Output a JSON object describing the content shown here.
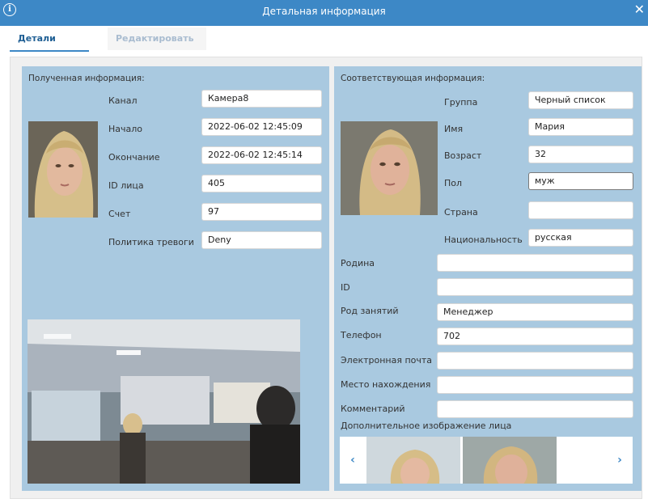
{
  "window": {
    "title": "Детальная информация"
  },
  "tabs": {
    "details": "Детали",
    "edit": "Редактировать"
  },
  "left": {
    "heading": "Полученная информация:",
    "fields": [
      {
        "label": "Канал",
        "value": "Камера8"
      },
      {
        "label": "Начало",
        "value": "2022-06-02 12:45:09"
      },
      {
        "label": "Окончание",
        "value": "2022-06-02 12:45:14"
      },
      {
        "label": "ID лица",
        "value": "405"
      },
      {
        "label": "Счет",
        "value": "97"
      },
      {
        "label": "Политика тревоги",
        "value": "Deny"
      }
    ]
  },
  "right": {
    "heading": "Соответствующая информация:",
    "fields": [
      {
        "label": "Группа",
        "value": "Черный список"
      },
      {
        "label": "Имя",
        "value": "Мария"
      },
      {
        "label": "Возраст",
        "value": "32"
      },
      {
        "label": "Пол",
        "value": "муж"
      },
      {
        "label": "Страна",
        "value": ""
      },
      {
        "label": "Национальность",
        "value": "русская"
      }
    ],
    "wide_fields": [
      {
        "label": "Родина",
        "value": ""
      },
      {
        "label": "ID",
        "value": ""
      },
      {
        "label": "Род занятий",
        "value": "Менеджер"
      },
      {
        "label": "Телефон",
        "value": "702"
      },
      {
        "label": "Электронная почта",
        "value": ""
      },
      {
        "label": "Место нахождения",
        "value": ""
      },
      {
        "label": "Комментарий",
        "value": ""
      }
    ],
    "extra_images_label": "Дополнительное изображение лица",
    "prev": "‹",
    "next": "›"
  },
  "colors": {
    "accent": "#3d88c6",
    "panel": "#a9c9e0"
  }
}
